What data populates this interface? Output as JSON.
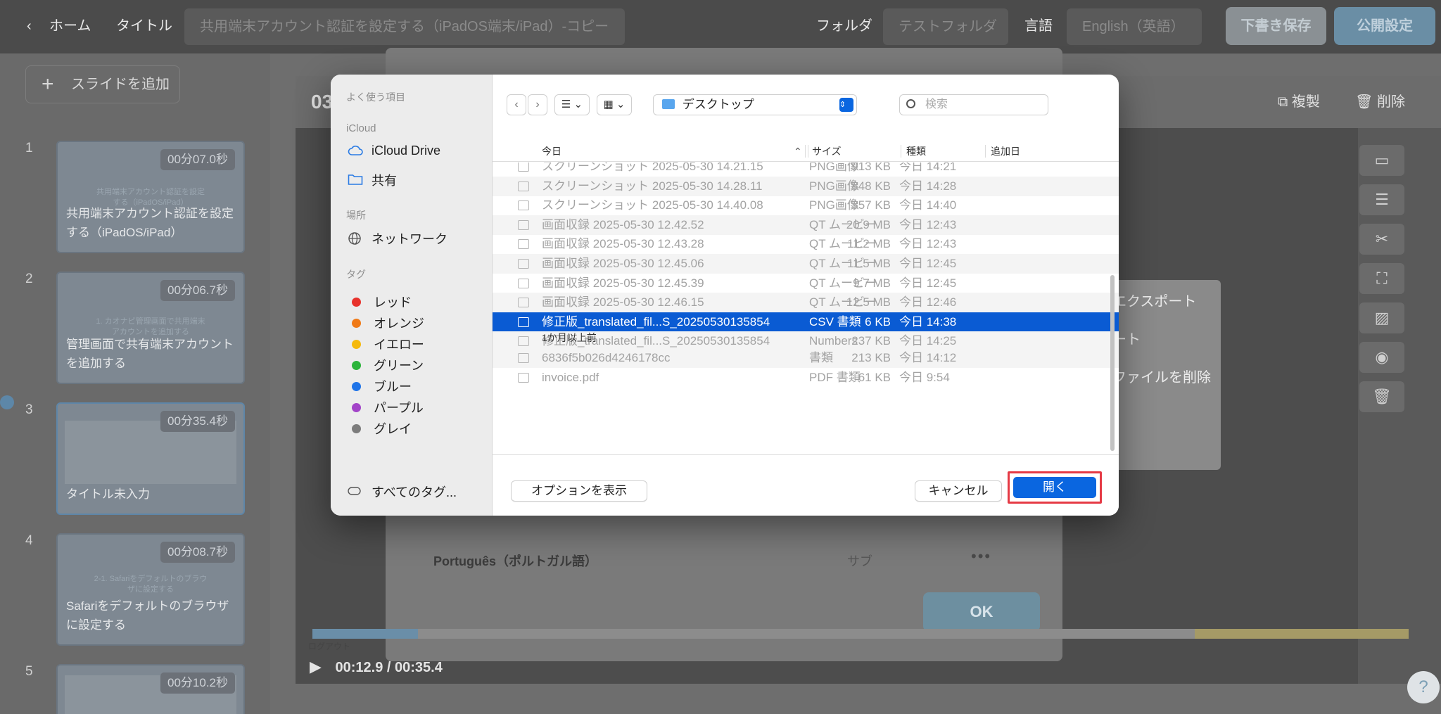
{
  "topbar": {
    "home": "ホーム",
    "title_label": "タイトル",
    "title_value": "共用端末アカウント認証を設定する（iPadOS端末/iPad）-コピー",
    "folder_label": "フォルダ",
    "folder_value": "テストフォルダ",
    "language_label": "言語",
    "language_value": "English（英語）",
    "save_draft": "下書き保存",
    "publish": "公開設定"
  },
  "sidebar": {
    "add_slide": "スライドを追加",
    "slides": [
      {
        "num": "1",
        "duration": "00分07.0秒",
        "caption": "共用端末アカウント認証を設定する（iPadOS/iPad）",
        "mini": "共用端末アカウント認証を設定する（iPadOS/iPad）"
      },
      {
        "num": "2",
        "duration": "00分06.7秒",
        "caption": "管理画面で共有端末アカウントを追加する",
        "mini": "1. カオナビ管理画面で共用端末アカウントを追加する"
      },
      {
        "num": "3",
        "duration": "00分35.4秒",
        "caption": "タイトル未入力",
        "mini": ""
      },
      {
        "num": "4",
        "duration": "00分08.7秒",
        "caption": "Safariをデフォルトのブラウザに設定する",
        "mini": "2-1. Safariをデフォルトのブラウザに設定する"
      },
      {
        "num": "5",
        "duration": "00分10.2秒",
        "caption": "",
        "mini": ""
      }
    ]
  },
  "editor": {
    "slide_no": "03",
    "duplicate": "複製",
    "delete": "削除",
    "time": "00:12.9 / 00:35.4",
    "logout_label": "ログアウト"
  },
  "background_dialog": {
    "lang_row": "Português（ポルトガル語）",
    "lang_type": "サブ",
    "more": "•••",
    "ok": "OK"
  },
  "context_menu": {
    "items": [
      "エクスポート",
      "ート",
      "ファイルを削除"
    ]
  },
  "file_dialog": {
    "sidebar": {
      "favorites_header": "よく使う項目",
      "icloud_header": "iCloud",
      "icloud_drive": "iCloud Drive",
      "shared": "共有",
      "locations_header": "場所",
      "network": "ネットワーク",
      "tags_header": "タグ",
      "tags": [
        {
          "name": "レッド",
          "color": "#e8322c"
        },
        {
          "name": "オレンジ",
          "color": "#f07a17"
        },
        {
          "name": "イエロー",
          "color": "#f5b90c"
        },
        {
          "name": "グリーン",
          "color": "#2bb43a"
        },
        {
          "name": "ブルー",
          "color": "#1f74e8"
        },
        {
          "name": "パープル",
          "color": "#a244c8"
        },
        {
          "name": "グレイ",
          "color": "#7c7c7c"
        }
      ],
      "all_tags": "すべてのタグ..."
    },
    "location": "デスクトップ",
    "search_placeholder": "検索",
    "columns": {
      "name": "今日",
      "size": "サイズ",
      "kind": "種類",
      "added": "追加日"
    },
    "rows_today": [
      {
        "name": "スクリーンショット 2025-05-30 14.21.15",
        "size": "913 KB",
        "kind": "PNG画像",
        "added": "今日 14:21"
      },
      {
        "name": "スクリーンショット 2025-05-30 14.28.11",
        "size": "848 KB",
        "kind": "PNG画像",
        "added": "今日 14:28"
      },
      {
        "name": "スクリーンショット 2025-05-30 14.40.08",
        "size": "357 KB",
        "kind": "PNG画像",
        "added": "今日 14:40"
      },
      {
        "name": "画面収録 2025-05-30 12.42.52",
        "size": "20.9 MB",
        "kind": "QT ムービー",
        "added": "今日 12:43"
      },
      {
        "name": "画面収録 2025-05-30 12.43.28",
        "size": "11.2 MB",
        "kind": "QT ムービー",
        "added": "今日 12:43"
      },
      {
        "name": "画面収録 2025-05-30 12.45.06",
        "size": "11.5 MB",
        "kind": "QT ムービー",
        "added": "今日 12:45"
      },
      {
        "name": "画面収録 2025-05-30 12.45.39",
        "size": "9.7 MB",
        "kind": "QT ムービー",
        "added": "今日 12:45"
      },
      {
        "name": "画面収録 2025-05-30 12.46.15",
        "size": "12.5 MB",
        "kind": "QT ムービー",
        "added": "今日 12:46"
      },
      {
        "name": "修正版_translated_fil...S_20250530135854",
        "size": "6 KB",
        "kind": "CSV 書類",
        "added": "今日 14:38"
      },
      {
        "name": "修正版_translated_fil...S_20250530135854",
        "size": "237 KB",
        "kind": "Numbers",
        "added": "今日 14:25"
      }
    ],
    "older_header": "1か月以上前",
    "rows_older": [
      {
        "name": "6836f5b026d4246178cc",
        "size": "213 KB",
        "kind": "書類",
        "added": "今日 14:12"
      },
      {
        "name": "invoice.pdf",
        "size": "61 KB",
        "kind": "PDF 書類",
        "added": "今日 9:54"
      }
    ],
    "show_options": "オプションを表示",
    "cancel": "キャンセル",
    "open": "開く"
  }
}
